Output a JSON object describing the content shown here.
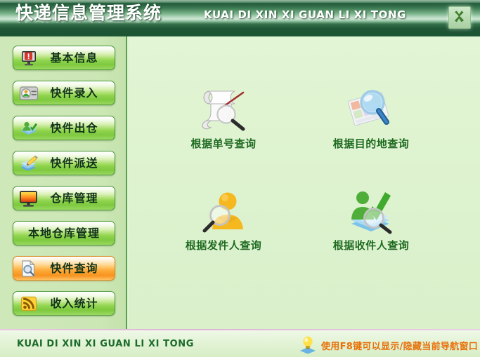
{
  "header": {
    "title_zh": "快递信息管理系统",
    "title_pinyin": "KUAI DI XIN XI GUAN LI XI TONG",
    "close_label": "×",
    "close_icon": "close-icon",
    "colors": {
      "header_dark_green": "#1b5233",
      "header_light_band": "#cfe6d5",
      "title_text": "#ffffff"
    }
  },
  "sidebar": {
    "items": [
      {
        "label": "基本信息",
        "icon": "monitor-alert-icon",
        "selected": false
      },
      {
        "label": "快件录入",
        "icon": "id-card-user-icon",
        "selected": false
      },
      {
        "label": "快件出仓",
        "icon": "user-book-out-icon",
        "selected": false
      },
      {
        "label": "快件派送",
        "icon": "books-pencil-icon",
        "selected": false
      },
      {
        "label": "仓库管理",
        "icon": "monitor-warehouse-icon",
        "selected": false
      },
      {
        "label": "本地仓库管理",
        "icon": "none",
        "selected": false
      },
      {
        "label": "快件查询",
        "icon": "document-search-icon",
        "selected": true
      },
      {
        "label": "收入统计",
        "icon": "rss-chart-icon",
        "selected": false
      }
    ],
    "colors": {
      "background": "#cfe8b9",
      "button_green": "#8ed44c",
      "button_selected_orange": "#fca430",
      "border": "#57a150"
    }
  },
  "main": {
    "tiles": [
      {
        "label": "根据单号查询",
        "icon": "scroll-magnifier-icon"
      },
      {
        "label": "根据目的地查询",
        "icon": "map-magnifier-icon"
      },
      {
        "label": "根据发件人查询",
        "icon": "sender-person-magnifier-icon"
      },
      {
        "label": "根据收件人查询",
        "icon": "receiver-person-check-magnifier-icon"
      }
    ],
    "colors": {
      "background": "#ddf2ce",
      "label_text": "#1d6b1d"
    }
  },
  "statusbar": {
    "left_text": "KUAI DI XIN XI GUAN LI XI TONG",
    "hint_text": "使用F8键可以显示/隐藏当前导航窗口",
    "hint_icon": "lightbulb-icon",
    "colors": {
      "left_text": "#1b6b2a",
      "hint_text": "#e8710a"
    }
  }
}
